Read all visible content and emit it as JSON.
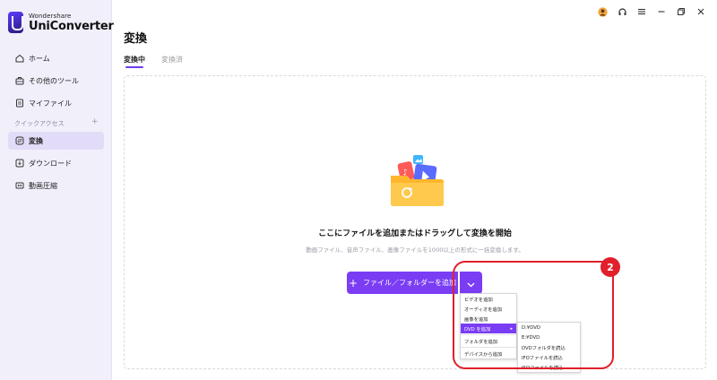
{
  "app": {
    "brand_small": "Wondershare",
    "brand_name": "UniConverter"
  },
  "sidebar": {
    "items": [
      {
        "label": "ホーム",
        "icon": "home-icon"
      },
      {
        "label": "その他のツール",
        "icon": "toolbox-icon"
      },
      {
        "label": "マイファイル",
        "icon": "file-icon"
      },
      {
        "label": "変換",
        "icon": "convert-icon",
        "active": true
      },
      {
        "label": "ダウンロード",
        "icon": "download-icon"
      },
      {
        "label": "動画圧縮",
        "icon": "compress-icon"
      }
    ],
    "quick_access_label": "クイックアクセス",
    "quick_access_add": "+"
  },
  "main": {
    "title": "変換",
    "tabs": [
      {
        "label": "変換中",
        "active": true
      },
      {
        "label": "変換済"
      }
    ],
    "drop_title": "ここにファイルを追加またはドラッグして変換を開始",
    "drop_subtitle": "動画ファイル、音声ファイル、画像ファイルを1000以上の形式に一括変換します。",
    "add_button_label": "ファイル／フォルダーを追加",
    "add_button_plus": "+"
  },
  "add_menu": {
    "items": [
      "ビデオを追加",
      "オーディオを追加",
      "画像を追加",
      "DVD を追加",
      "フォルダを追加",
      "デバイスから追加"
    ],
    "highlight_arrow": "▸"
  },
  "dvd_submenu": {
    "items": [
      "D:¥DVD",
      "E:¥DVD",
      "DVDフォルダを読込",
      "IFOファイルを読込",
      "ISOファイルを読込"
    ]
  },
  "annotation": {
    "badge": "2"
  },
  "colors": {
    "accent": "#7b3df4",
    "annotation": "#e0202a",
    "sidebar_bg": "#f1effa"
  }
}
